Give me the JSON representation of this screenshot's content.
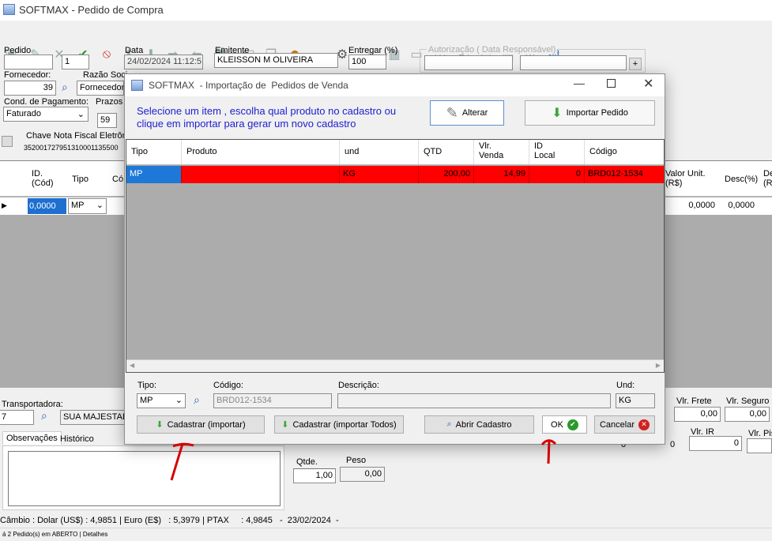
{
  "window": {
    "title": "SOFTMAX - Pedido de Compra"
  },
  "icons": [
    "new-icon",
    "edit-icon",
    "delete-icon",
    "confirm-icon",
    "cancel-icon",
    "up-icon",
    "down-icon",
    "forward-icon",
    "back-icon",
    "print-icon",
    "export-icon",
    "copy-icon",
    "users-icon",
    "truck-icon",
    "gear-icon",
    "search-icon",
    "grid-icon",
    "car-icon",
    "box-icon",
    "doc-icon",
    "image-icon"
  ],
  "form": {
    "pedido_label": "Pedido",
    "pedido_value": "1",
    "data_label": "Data",
    "data_value": "24/02/2024 11:12:5",
    "emitente_label": "Emitente",
    "emitente_value": "KLEISSON M OLIVEIRA",
    "entregar_label": "Entregar (%)",
    "entregar_value": "100",
    "autorizacao_label": "Autorização ( Data Responsável)",
    "fornecedor_label": "Fornecedor:",
    "fornecedor_value": "39",
    "razao_label": "Razão Soci",
    "razao_value": "Fornecedor/",
    "cond_label": "Cond. de Pagamento:",
    "cond_value": "Faturado",
    "prazos_label": "Prazos",
    "prazos_value": "59",
    "chave_label": "Chave Nota Fiscal Eletrôni",
    "chave_value": "352001727951310001135500"
  },
  "items_grid": {
    "headers": [
      "ID.\n(Cód)",
      "Tipo",
      "Có"
    ],
    "row": {
      "id": "0,0000",
      "tipo": "MP"
    },
    "right_headers": [
      "Valor Unit. (R$)",
      "Desc(%)",
      "De (R"
    ],
    "right_values": [
      "0,0000",
      "0,0000"
    ]
  },
  "bottom": {
    "transportadora_label": "Transportadora:",
    "transportadora_code": "7",
    "transportadora_name": "SUA MAJESTADE",
    "tab_obs": "Observações",
    "tab_hist": "Histórico",
    "qtde_label": "Qtde.",
    "qtde_value": "1,00",
    "peso_label": "Peso",
    "peso_value": "0,00",
    "frete_label": "Vlr. Frete",
    "frete_value": "0,00",
    "seguro_label": "Vlr. Seguro",
    "seguro_value": "0,00",
    "ir_label": "Vlr. IR",
    "ir_value": "0",
    "pis_label": "Vlr. Pis",
    "zero_a": "0",
    "zero_b": "0",
    "cambio": "Câmbio : Dolar (US$) : 4,9851 | Euro (E$)   : 5,3979 | PTAX     : 4,9845   -  23/02/2024  -",
    "status": "á 2  Pedido(s) em ABERTO  | Detalhes"
  },
  "modal": {
    "title": "SOFTMAX  - Importação de  Pedidos de Venda",
    "instruction": "Selecione um item ,  escolha qual produto no cadastro ou clique em importar para gerar um novo cadastro",
    "alterar": "Alterar",
    "importar": "Importar Pedido",
    "columns": [
      "Tipo",
      "Produto",
      "und",
      "QTD",
      "Vlr.\nVenda",
      "ID\nLocal",
      "Código"
    ],
    "row": {
      "tipo": "MP",
      "produto": "",
      "und": "KG",
      "qtd": "200,00",
      "venda": "14,99",
      "local": "0",
      "codigo": "BRD012-1534"
    },
    "tipo_label": "Tipo:",
    "tipo_value": "MP",
    "codigo_label": "Código:",
    "codigo_value": "BRD012-1534",
    "descricao_label": "Descrição:",
    "descricao_value": "",
    "und_label": "Und:",
    "und_value": "KG",
    "btn_cadastrar": "Cadastrar (importar)",
    "btn_cadastrar_todos": "Cadastrar (importar Todos)",
    "btn_abrir": "Abrir Cadastro",
    "btn_ok": "OK",
    "btn_cancelar": "Cancelar"
  }
}
